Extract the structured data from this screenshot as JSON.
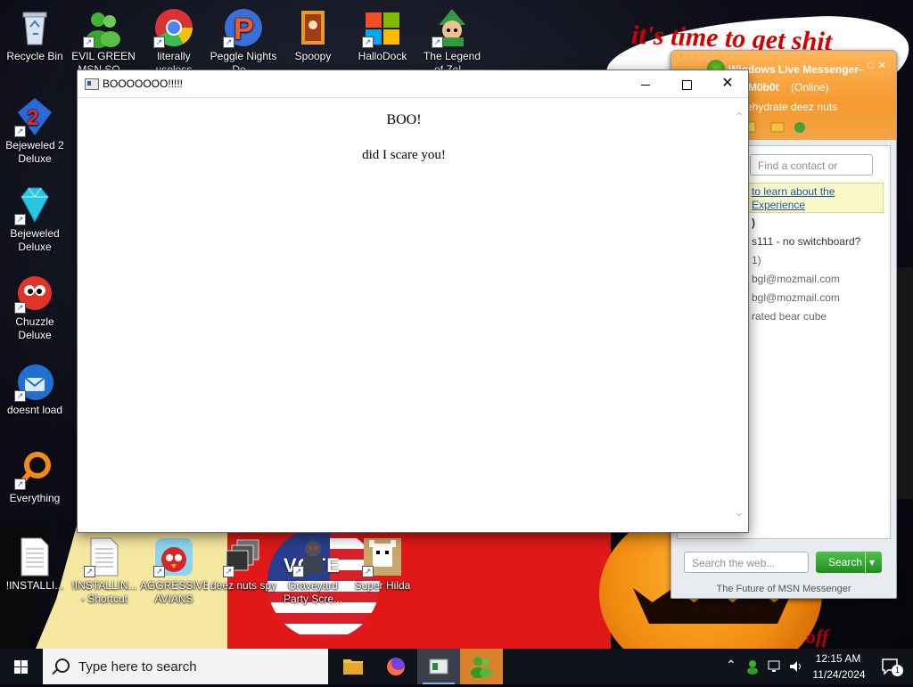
{
  "wallpaper": {
    "banner_text": "it's time to get shit",
    "flag_text": "VOTE",
    "corner_text": "off"
  },
  "desktop_icons": [
    {
      "label": "Recycle Bin",
      "icon": "recycle-bin-icon"
    },
    {
      "label": "EVIL GREEN MSN SQ...",
      "icon": "msn-people-icon"
    },
    {
      "label": "literally useless",
      "icon": "chrome-icon"
    },
    {
      "label": "Peggle Nights De...",
      "icon": "peggle-icon"
    },
    {
      "label": "Spoopy",
      "icon": "spoopy-icon"
    },
    {
      "label": "HalloDock",
      "icon": "windows-logo-icon"
    },
    {
      "label": "The Legend of Zel...",
      "icon": "zelda-icon"
    },
    {
      "label": "Bejeweled 2 Deluxe",
      "icon": "bejeweled2-icon"
    },
    {
      "label": "Bejeweled Deluxe",
      "icon": "bejeweled-icon"
    },
    {
      "label": "Chuzzle Deluxe",
      "icon": "chuzzle-icon"
    },
    {
      "label": "doesnt load",
      "icon": "thunderbird-icon"
    },
    {
      "label": "Everything",
      "icon": "everything-search-icon"
    },
    {
      "label": "!INSTALLI...",
      "icon": "text-file-icon"
    },
    {
      "label": "!INSTALLIN... - Shortcut",
      "icon": "text-file-icon"
    },
    {
      "label": "AGGRESSIVE AVIANS",
      "icon": "angry-bird-icon"
    },
    {
      "label": "deez nuts spy",
      "icon": "windows-stack-icon"
    },
    {
      "label": "Graveyard Party Scre...",
      "icon": "graveyard-icon"
    },
    {
      "label": "Super Hilda",
      "icon": "hilda-icon"
    }
  ],
  "msn": {
    "title": "Windows Live Messenger",
    "username": "M0b0t",
    "status": "(Online)",
    "personal_message": "ehydrate deez nuts",
    "find_placeholder": "Find a contact or number",
    "ad_line1": "to learn about the",
    "ad_line2": "Experience",
    "rows": [
      ")",
      "s111 - no switchboard?",
      "1)",
      "bgl@mozmail.com",
      "bgl@mozmail.com",
      "rated bear cube"
    ],
    "search_placeholder": "Search the web...",
    "search_button": "Search",
    "footer": "The Future of MSN Messenger"
  },
  "window": {
    "title": "BOOOOOOO!!!!!",
    "heading": "BOO!",
    "message": "did I scare you!"
  },
  "taskbar": {
    "search_placeholder": "Type here to search",
    "apps": [
      "file-explorer-icon",
      "firefox-icon",
      "app-window-icon",
      "msn-messenger-icon"
    ],
    "time": "12:15 AM",
    "date": "11/24/2024",
    "notifications": "1"
  },
  "colors": {
    "msn_orange": "#f59a2e",
    "taskbar": "#10131a",
    "link_blue": "#1b57b8",
    "search_green": "#2ea52c"
  }
}
